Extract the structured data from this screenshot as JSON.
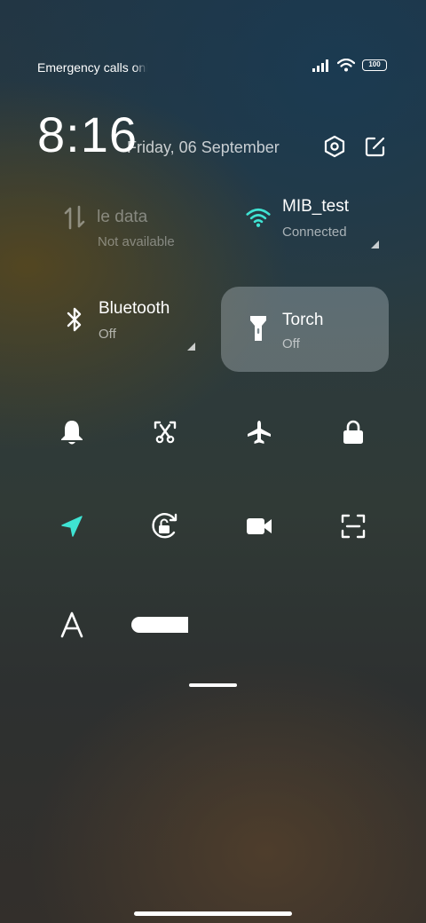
{
  "status_bar": {
    "carrier_text": "Emergency calls only",
    "battery_level": "100",
    "icons": [
      "signal-icon",
      "wifi-icon",
      "battery-icon"
    ]
  },
  "header": {
    "time": "8:16",
    "date": "Friday, 06 September",
    "icons": [
      "settings-icon",
      "edit-icon"
    ]
  },
  "tiles": {
    "mobile_data": {
      "title": "Mobile data",
      "subtitle": "Not available",
      "icon": "mobile-data-icon"
    },
    "wifi": {
      "title": "MIB_test",
      "subtitle": "Connected",
      "icon": "wifi-icon"
    },
    "bluetooth": {
      "title": "Bluetooth",
      "subtitle": "Off",
      "icon": "bluetooth-icon"
    },
    "torch": {
      "title": "Torch",
      "subtitle": "Off",
      "icon": "torch-icon"
    }
  },
  "toggles": [
    "bell-icon",
    "screenshot-icon",
    "airplane-icon",
    "lock-icon",
    "location-icon",
    "rotation-lock-icon",
    "video-icon",
    "scan-icon"
  ],
  "colors": {
    "accent": "#3fe3d3",
    "active_tile": "#cdd7dc"
  }
}
